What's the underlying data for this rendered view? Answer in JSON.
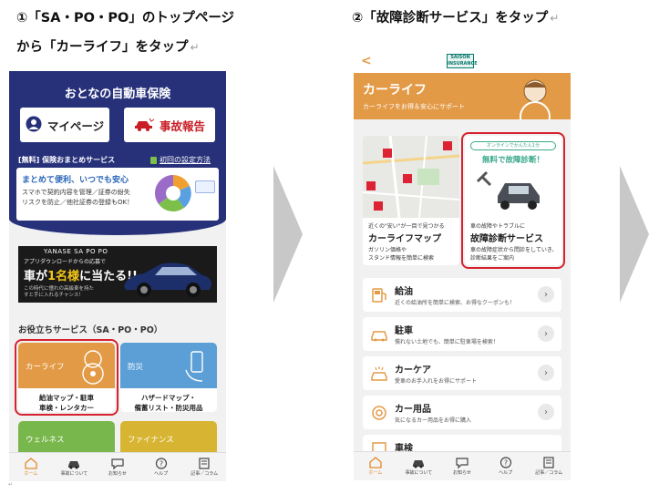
{
  "captions": {
    "step1_line1": "①「SA・PO・PO」のトップページ",
    "step1_line2": "から「カーライフ」をタップ",
    "step2": "②「故障診断サービス」をタップ",
    "return_mark": "↵"
  },
  "footnote": "↵",
  "screen1": {
    "title": "おとなの自動車保険",
    "mypage_button": "マイページ",
    "accident_button": "事故報告",
    "service_label": "[無料] 保険おまとめサービス",
    "setup_link": "初回の設定方法",
    "card_headline": "まとめて便利、いつでも安心",
    "card_text1": "スマホで契約内容を管理／証券の紛失",
    "card_text2": "リスクを防止／他社証券の登録もOK！",
    "banner": {
      "brand": "YANASE SA PO PO",
      "sub": "アプリダウンロードからの応募で",
      "main_pre": "車が",
      "main_hl": "1名様",
      "main_post": "に当たる!!",
      "foot": "この時代に憧れの高級車を持たすと手に入れるチャンス！"
    },
    "section_title": "お役立ちサービス（SA・PO・PO）",
    "tiles": [
      {
        "label": "カーライフ",
        "desc1": "給油マップ・駐車",
        "desc2": "車検・レンタカー"
      },
      {
        "label": "防災",
        "desc1": "ハザードマップ・",
        "desc2": "備蓄リスト・防災用品"
      },
      {
        "label": "ウェルネス",
        "desc1": "",
        "desc2": ""
      },
      {
        "label": "ファイナンス",
        "desc1": "",
        "desc2": ""
      }
    ]
  },
  "screen2": {
    "back_label": "<",
    "logo_line1": "SAISON",
    "logo_line2": "INSURANCE",
    "banner_title": "カーライフ",
    "banner_sub": "カーライフをお得＆安心にサポート",
    "map_card": {
      "small": "近くの\"安い\"が一目で見つかる",
      "title": "カーライフマップ",
      "text1": "ガソリン価格や",
      "text2": "スタンド情報を簡単に検索"
    },
    "diag_card": {
      "badge": "オンラインでかんたん1分",
      "free": "無料で故障診断！",
      "small": "車の故障やトラブルに",
      "title": "故障診断サービス",
      "text1": "車の故障症状から問診をしていき、",
      "text2": "診断結果をご案内"
    },
    "rows": [
      {
        "title": "給油",
        "sub": "近くの給油所を簡単に検索、お得なクーポンも！"
      },
      {
        "title": "駐車",
        "sub": "慣れない土地でも、簡単に駐車場を検索！"
      },
      {
        "title": "カーケア",
        "sub": "愛車のお手入れをお得にサポート"
      },
      {
        "title": "カー用品",
        "sub": "気になるカー用品をお得に購入"
      },
      {
        "title": "車検",
        "sub": ""
      }
    ]
  },
  "nav": [
    "ホーム",
    "事故について",
    "お知らせ",
    "ヘルプ",
    "記事／コラム"
  ],
  "colors": {
    "navy": "#27317a",
    "orange": "#e39a46",
    "red": "#d6222f"
  }
}
